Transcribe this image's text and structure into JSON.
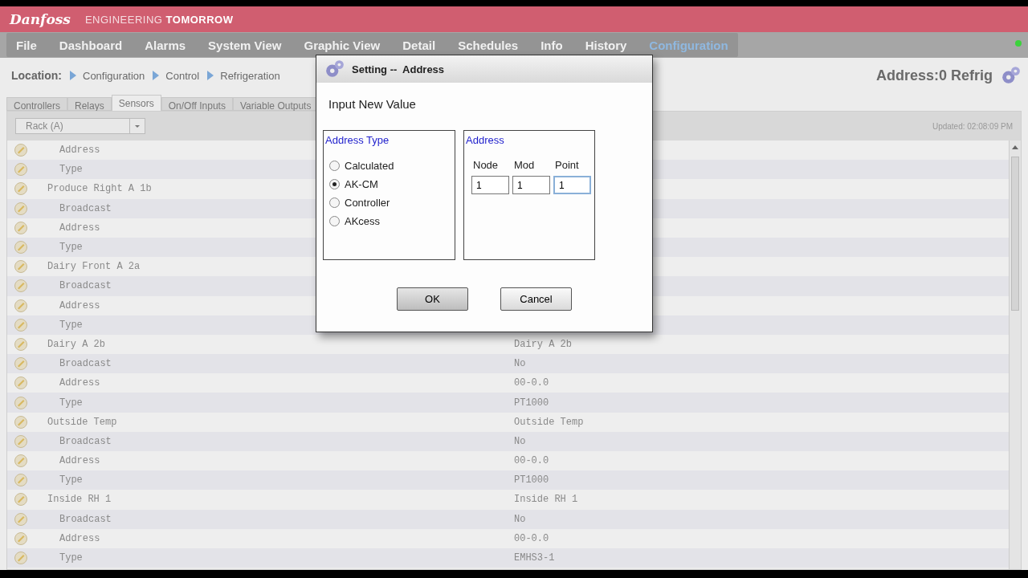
{
  "header": {
    "logo": "Danfoss",
    "tagline_light": "ENGINEERING",
    "tagline_bold": "TOMORROW"
  },
  "menu": [
    {
      "label": "File",
      "selected": false
    },
    {
      "label": "Dashboard",
      "selected": false
    },
    {
      "label": "Alarms",
      "selected": false
    },
    {
      "label": "System View",
      "selected": false
    },
    {
      "label": "Graphic View",
      "selected": false
    },
    {
      "label": "Detail",
      "selected": false
    },
    {
      "label": "Schedules",
      "selected": false
    },
    {
      "label": "Info",
      "selected": false
    },
    {
      "label": "History",
      "selected": false
    },
    {
      "label": "Configuration",
      "selected": true
    }
  ],
  "location": {
    "label": "Location:",
    "crumbs": [
      "Configuration",
      "Control",
      "Refrigeration"
    ]
  },
  "device": "Address:0 Refrig",
  "tabs": [
    {
      "label": "Controllers",
      "selected": false
    },
    {
      "label": "Relays",
      "selected": false
    },
    {
      "label": "Sensors",
      "selected": true
    },
    {
      "label": "On/Off Inputs",
      "selected": false
    },
    {
      "label": "Variable Outputs",
      "selected": false
    }
  ],
  "rack_select": {
    "value": "Rack (A)"
  },
  "updated": "Updated: 02:08:09 PM",
  "sensors": [
    {
      "children": [
        {
          "name": "Address"
        },
        {
          "name": "Type"
        }
      ]
    },
    {
      "name": "Produce Right A 1b",
      "children": [
        {
          "name": "Broadcast"
        },
        {
          "name": "Address"
        },
        {
          "name": "Type"
        }
      ]
    },
    {
      "name": "Dairy Front A 2a",
      "children": [
        {
          "name": "Broadcast"
        },
        {
          "name": "Address"
        },
        {
          "name": "Type"
        }
      ]
    },
    {
      "name": "Dairy A 2b",
      "value": "Dairy A 2b",
      "children": [
        {
          "name": "Broadcast",
          "value": "No"
        },
        {
          "name": "Address",
          "value": "00-0.0"
        },
        {
          "name": "Type",
          "value": "PT1000"
        }
      ]
    },
    {
      "name": "Outside Temp",
      "value": "Outside Temp",
      "children": [
        {
          "name": "Broadcast",
          "value": "No"
        },
        {
          "name": "Address",
          "value": "00-0.0"
        },
        {
          "name": "Type",
          "value": "PT1000"
        }
      ]
    },
    {
      "name": "Inside RH 1",
      "value": "Inside RH 1",
      "children": [
        {
          "name": "Broadcast",
          "value": "No"
        },
        {
          "name": "Address",
          "value": "00-0.0"
        },
        {
          "name": "Type",
          "value": "EMHS3-1"
        }
      ]
    }
  ],
  "dialog": {
    "title": "Setting --  Address",
    "prompt": "Input New Value",
    "type_group": {
      "legend": "Address Type",
      "options": [
        {
          "label": "Calculated",
          "selected": false
        },
        {
          "label": "AK-CM",
          "selected": true
        },
        {
          "label": "Controller",
          "selected": false
        },
        {
          "label": "AKcess",
          "selected": false
        }
      ]
    },
    "address_group": {
      "legend": "Address",
      "fields": [
        {
          "label": "Node",
          "value": "1",
          "focused": false
        },
        {
          "label": "Mod",
          "value": "1",
          "focused": false
        },
        {
          "label": "Point",
          "value": "1",
          "focused": true
        }
      ]
    },
    "buttons": [
      {
        "label": "OK",
        "kind": "primary"
      },
      {
        "label": "Cancel",
        "kind": "secondary"
      }
    ]
  }
}
